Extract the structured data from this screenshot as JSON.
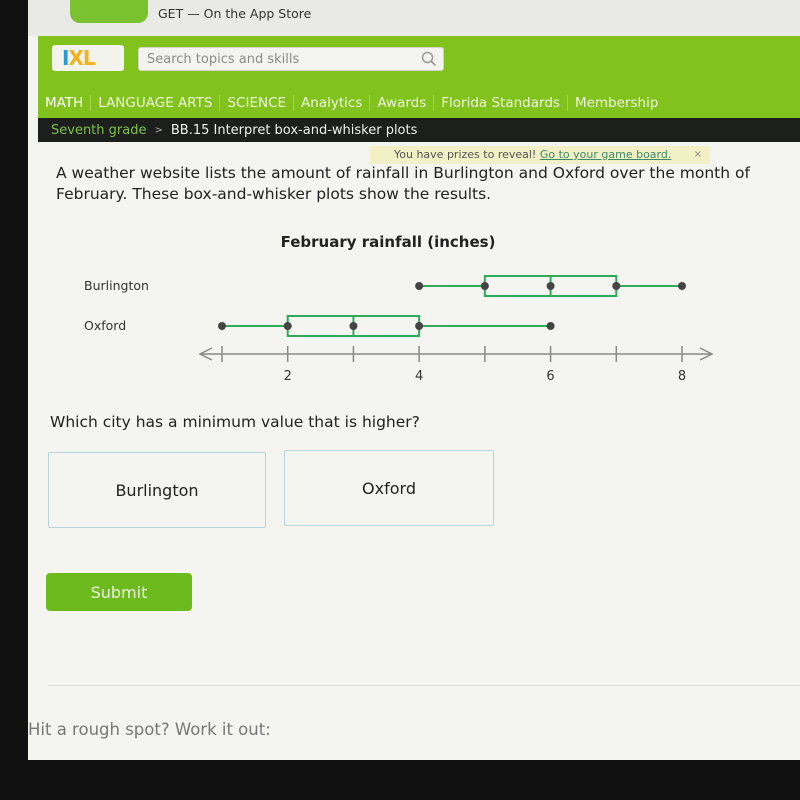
{
  "app_banner": {
    "text": "GET — On the App Store"
  },
  "header": {
    "logo": {
      "i": "I",
      "xl": "XL"
    },
    "search": {
      "placeholder": "Search topics and skills",
      "icon": "search-icon"
    },
    "nav": [
      {
        "label": "MATH",
        "active": true
      },
      {
        "label": "LANGUAGE ARTS"
      },
      {
        "label": "SCIENCE"
      },
      {
        "label": "Analytics"
      },
      {
        "label": "Awards"
      },
      {
        "label": "Florida Standards"
      },
      {
        "label": "Membership"
      }
    ]
  },
  "breadcrumb": {
    "grade": "Seventh grade",
    "separator": ">",
    "skill": "BB.15 Interpret box-and-whisker plots"
  },
  "prize_banner": {
    "text": "You have prizes to reveal!",
    "link": "Go to your game board.",
    "close": "×"
  },
  "question": {
    "text": "A weather website lists the amount of rainfall in Burlington and Oxford over the month of February. These box-and-whisker plots show the results.",
    "prompt": "Which city has a minimum value that is higher?",
    "choices": [
      "Burlington",
      "Oxford"
    ],
    "submit_label": "Submit"
  },
  "footer": {
    "help_text": "Hit a rough spot? Work it out:"
  },
  "colors": {
    "brand_green": "#82c21c",
    "box_green": "#2eaa5a",
    "point_gray": "#444444"
  },
  "chart_data": {
    "type": "box",
    "title": "February rainfall (inches)",
    "xlim": [
      1,
      8
    ],
    "ticks": [
      1,
      2,
      3,
      4,
      5,
      6,
      7,
      8
    ],
    "tick_labels": [
      "",
      "2",
      "",
      "4",
      "",
      "6",
      "",
      "8"
    ],
    "series": [
      {
        "name": "Burlington",
        "min": 4,
        "q1": 5,
        "median": 6,
        "q3": 7,
        "max": 8
      },
      {
        "name": "Oxford",
        "min": 1,
        "q1": 2,
        "median": 3,
        "q3": 4,
        "max": 6
      }
    ]
  }
}
